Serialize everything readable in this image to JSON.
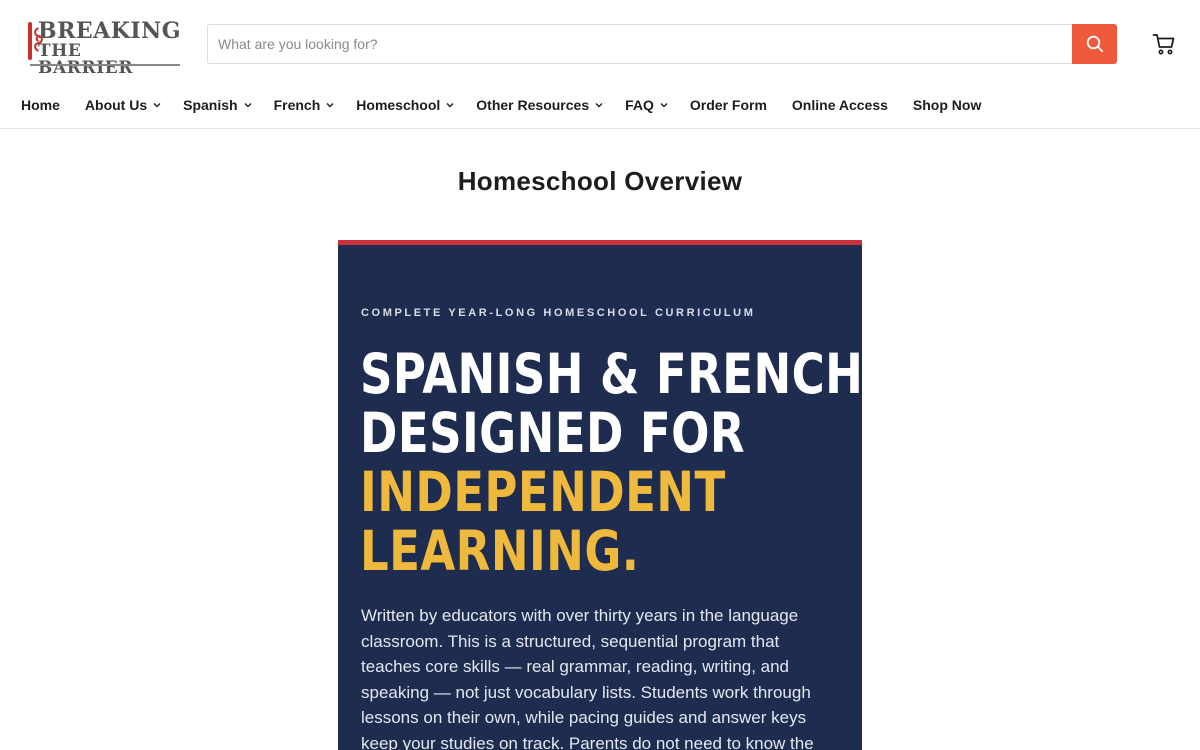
{
  "brand": {
    "line1": "BREAKING",
    "line2": "THE BARRIER",
    "accent_color": "#c9302c"
  },
  "search": {
    "placeholder": "What are you looking for?",
    "button_color": "#ef5a3c",
    "icon": "search-icon"
  },
  "cart": {
    "icon": "cart-icon"
  },
  "nav": {
    "items": [
      {
        "label": "Home",
        "has_dropdown": false
      },
      {
        "label": "About Us",
        "has_dropdown": true
      },
      {
        "label": "Spanish",
        "has_dropdown": true
      },
      {
        "label": "French",
        "has_dropdown": true
      },
      {
        "label": "Homeschool",
        "has_dropdown": true
      },
      {
        "label": "Other Resources",
        "has_dropdown": true
      },
      {
        "label": "FAQ",
        "has_dropdown": true
      },
      {
        "label": "Order Form",
        "has_dropdown": false
      },
      {
        "label": "Online Access",
        "has_dropdown": false
      },
      {
        "label": "Shop Now",
        "has_dropdown": false
      }
    ]
  },
  "page": {
    "title": "Homeschool Overview"
  },
  "hero": {
    "eyebrow": "COMPLETE YEAR-LONG HOMESCHOOL CURRICULUM",
    "headline_line1": "SPANISH & FRENCH,",
    "headline_line2": "DESIGNED FOR",
    "headline_line3": "INDEPENDENT",
    "headline_line4": "LEARNING.",
    "body": "Written by educators with over thirty years in the language classroom. This is a structured, sequential program that teaches core skills — real grammar, reading, writing, and speaking — not just vocabulary lists. Students work through lessons on their own, while pacing guides and answer keys keep your studies on track. Parents do not need to know the",
    "background_color": "#1e2c4f",
    "top_border_color": "#c9313e",
    "accent_color": "#efb93e"
  }
}
